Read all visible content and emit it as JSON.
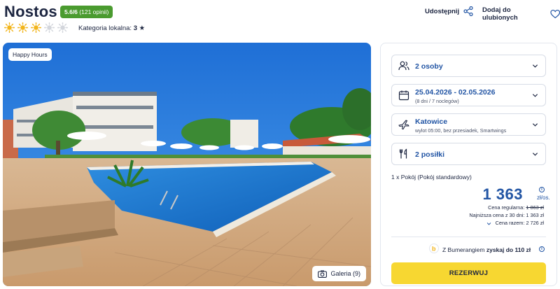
{
  "hotel": {
    "name": "Nostos",
    "rating": "5.6/6",
    "reviews": "(121 opinii)",
    "suns_filled": 3,
    "suns_total": 5,
    "category_label": "Kategoria lokalna:",
    "category_value": "3 ★"
  },
  "actions": {
    "share_label": "Udostępnij",
    "favorite_label": "Dodaj do ulubionych"
  },
  "photo": {
    "badge": "Happy Hours",
    "gallery_label": "Galeria (9)"
  },
  "booking": {
    "guests": "2 osoby",
    "dates": "25.04.2026 - 02.05.2026",
    "dates_sub": "(8 dni / 7 noclegów)",
    "departure": "Katowice",
    "departure_sub": "wylot 05:00, bez przesiadek, Smartwings",
    "meals": "2 posiłki",
    "room": "1 x Pokój   (Pokój standardowy)",
    "price": "1 363",
    "price_unit": "zł/os.",
    "regular_label": "Cena regularna:",
    "regular_value": "1 863 zł",
    "lowest_label": "Najniższa cena z 30 dni: 1 363 zł",
    "total_label": "Cena razem: 2 726 zł",
    "bumerang_pre": "Z Bumerangiem",
    "bumerang_bold": "zyskaj do 110 zł",
    "reserve_label": "REZERWUJ"
  },
  "colors": {
    "accent": "#2255a4",
    "rating_green": "#4a9b2f",
    "sun": "#f2b51c",
    "button": "#f7d731"
  },
  "icons": [
    "sun-icon",
    "share-icon",
    "heart-icon",
    "people-icon",
    "calendar-icon",
    "plane-icon",
    "cutlery-icon",
    "chevron-down-icon",
    "camera-icon",
    "info-icon",
    "bumerang-icon"
  ]
}
